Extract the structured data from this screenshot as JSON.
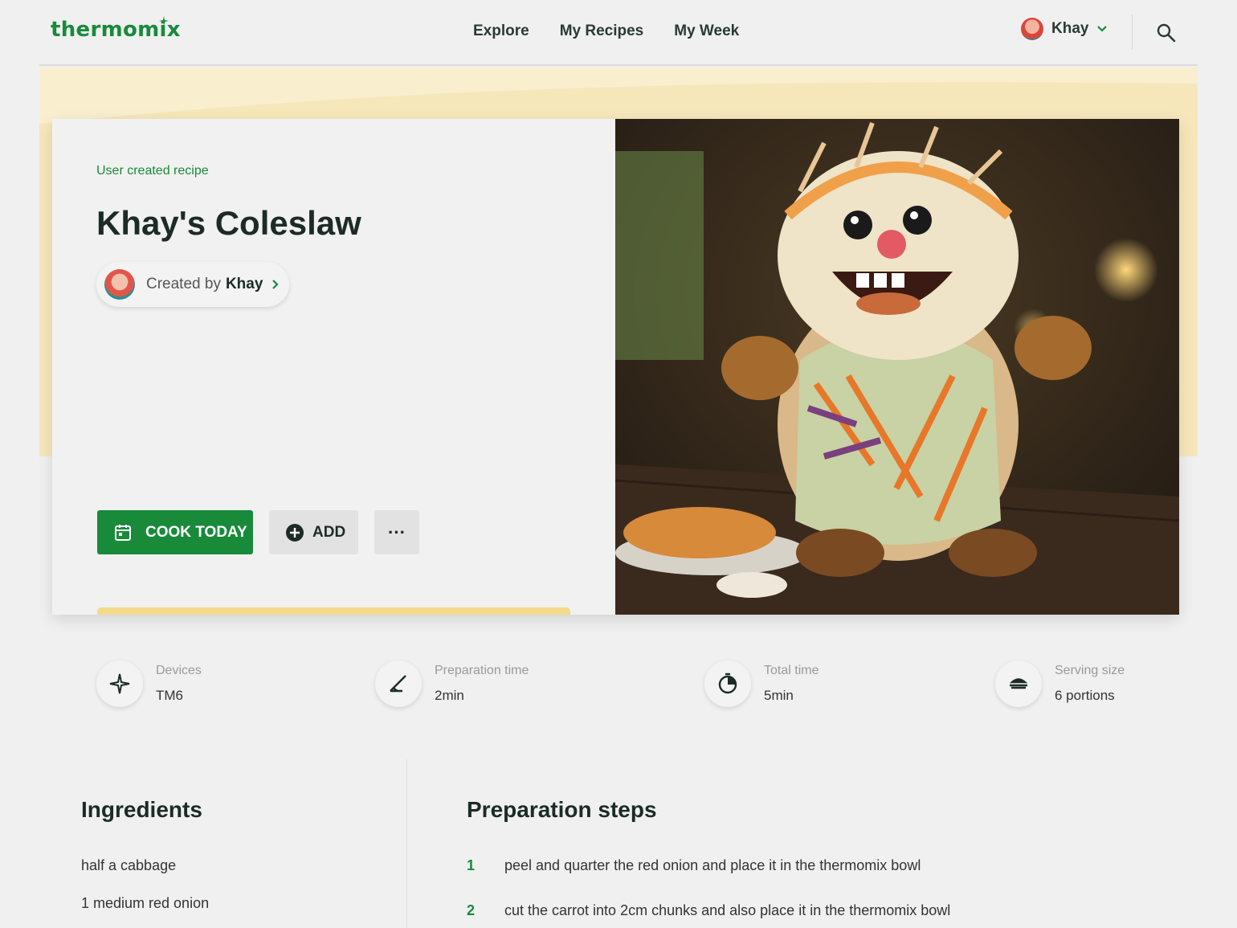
{
  "header": {
    "logo": "thermomix",
    "nav": [
      "Explore",
      "My Recipes",
      "My Week"
    ],
    "user_name": "Khay"
  },
  "recipe": {
    "badge": "User created recipe",
    "title": "Khay's Coleslaw",
    "created_by_label": "Created by",
    "creator_name": "Khay"
  },
  "actions": {
    "cook_today": "COOK TODAY",
    "add": "ADD",
    "more": "···"
  },
  "stats": [
    {
      "label": "Devices",
      "value": "TM6",
      "icon": "blade-icon"
    },
    {
      "label": "Preparation time",
      "value": "2min",
      "icon": "knife-icon"
    },
    {
      "label": "Total time",
      "value": "5min",
      "icon": "timer-icon"
    },
    {
      "label": "Serving size",
      "value": "6 portions",
      "icon": "serving-dish-icon"
    }
  ],
  "ingredients": {
    "title": "Ingredients",
    "items": [
      "half a cabbage",
      "1 medium red onion"
    ]
  },
  "steps": {
    "title": "Preparation steps",
    "items": [
      {
        "num": "1",
        "text": "peel and quarter the red onion and place it in the thermomix bowl"
      },
      {
        "num": "2",
        "text": "cut the carrot into 2cm chunks and also place it in the thermomix bowl"
      }
    ]
  },
  "colors": {
    "brand_green": "#188a3a",
    "hero_yellow": "#f4e4b2",
    "progress_yellow": "#f3d98a"
  }
}
